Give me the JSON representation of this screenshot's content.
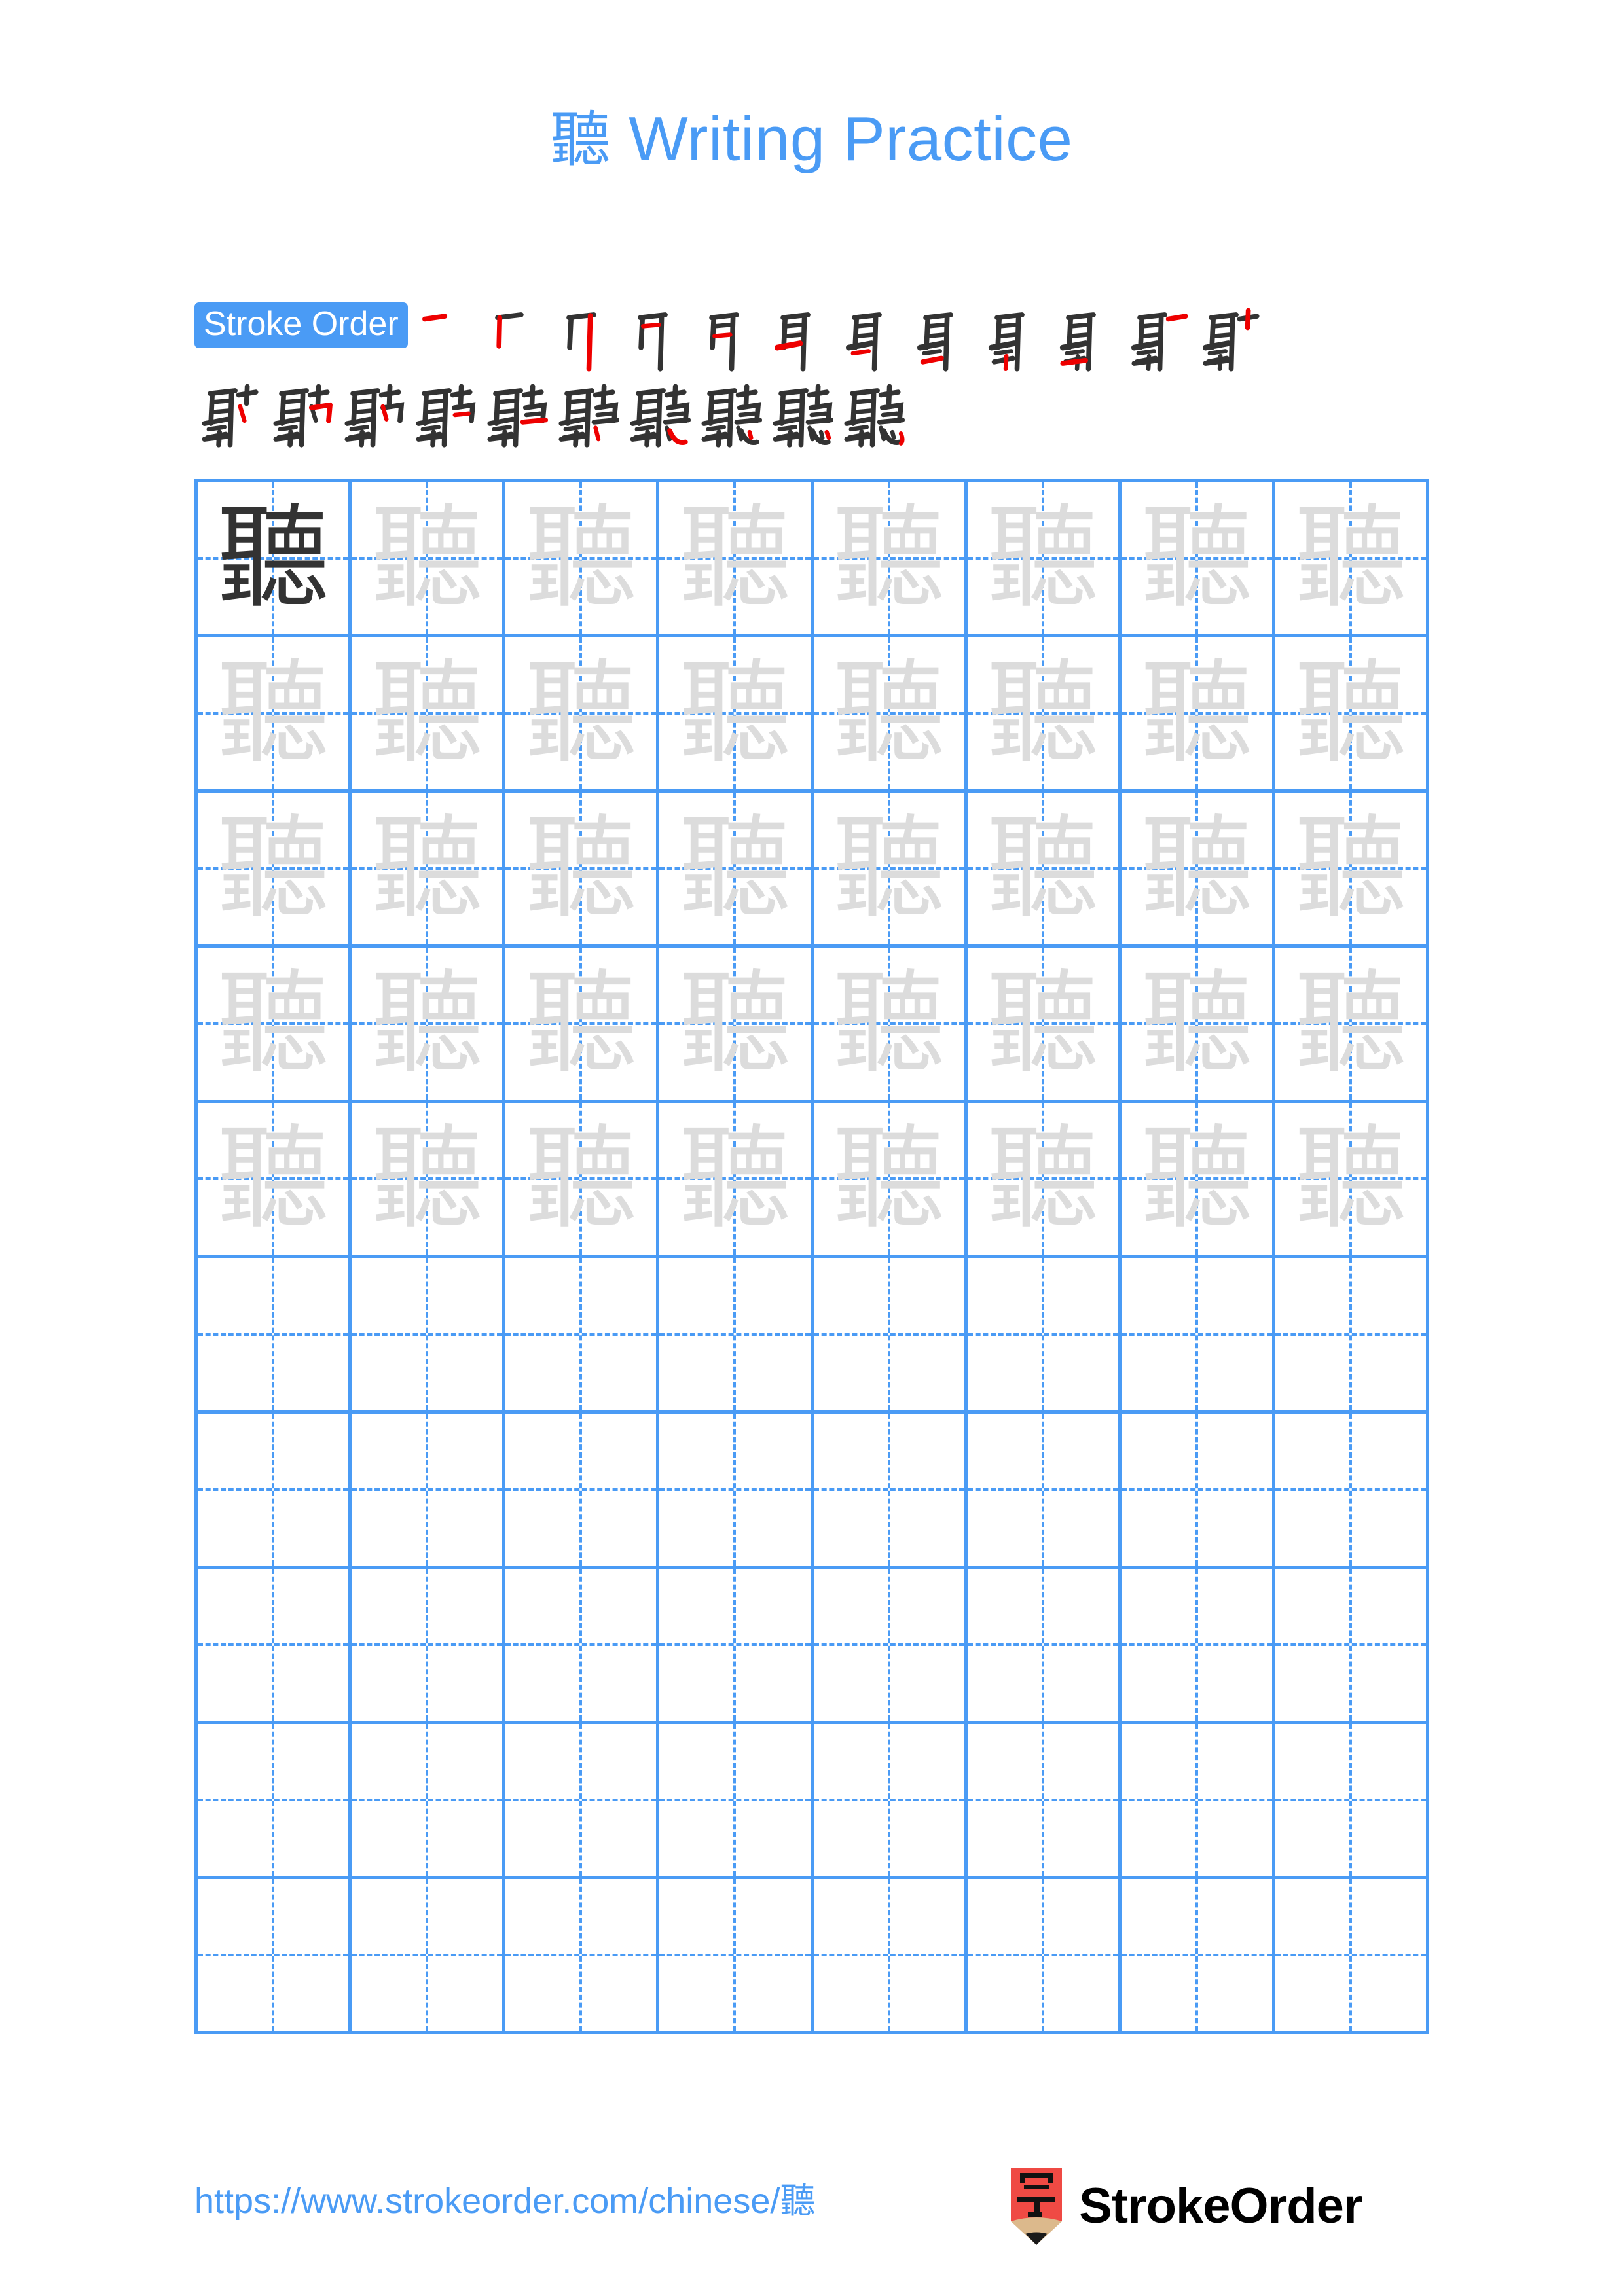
{
  "page": {
    "character": "聽",
    "title_suffix": " Writing Practice",
    "background_color": "#ffffff",
    "accent_color": "#4a9bf5",
    "trace_color": "#dcdcdc",
    "dark_color": "#333333",
    "stroke_new_color": "#ee0000",
    "stroke_old_color": "#333333"
  },
  "header": {
    "title_character": "聽",
    "title_text": "Writing Practice"
  },
  "stroke_order": {
    "badge_label": "Stroke Order",
    "total_strokes": 22,
    "row1_count": 12,
    "row2_count": 10,
    "characters_row1": [
      "一",
      "丆",
      "丌",
      "月",
      "月",
      "耳",
      "耳",
      "耳",
      "耳",
      "耵",
      "耵",
      "耺"
    ],
    "characters_row2": [
      "耺",
      "聍",
      "聍",
      "聍",
      "聽",
      "聽",
      "聽",
      "聽",
      "聽",
      "聽"
    ]
  },
  "practice_grid": {
    "columns": 8,
    "rows": 10,
    "character": "聽",
    "filled_rows": 5,
    "blank_rows": 5,
    "first_cell_style": "dark",
    "trace_cell_style": "trace",
    "rows_data": [
      [
        "dark",
        "trace",
        "trace",
        "trace",
        "trace",
        "trace",
        "trace",
        "trace"
      ],
      [
        "trace",
        "trace",
        "trace",
        "trace",
        "trace",
        "trace",
        "trace",
        "trace"
      ],
      [
        "trace",
        "trace",
        "trace",
        "trace",
        "trace",
        "trace",
        "trace",
        "trace"
      ],
      [
        "trace",
        "trace",
        "trace",
        "trace",
        "trace",
        "trace",
        "trace",
        "trace"
      ],
      [
        "trace",
        "trace",
        "trace",
        "trace",
        "trace",
        "trace",
        "trace",
        "trace"
      ],
      [
        "blank",
        "blank",
        "blank",
        "blank",
        "blank",
        "blank",
        "blank",
        "blank"
      ],
      [
        "blank",
        "blank",
        "blank",
        "blank",
        "blank",
        "blank",
        "blank",
        "blank"
      ],
      [
        "blank",
        "blank",
        "blank",
        "blank",
        "blank",
        "blank",
        "blank",
        "blank"
      ],
      [
        "blank",
        "blank",
        "blank",
        "blank",
        "blank",
        "blank",
        "blank",
        "blank"
      ],
      [
        "blank",
        "blank",
        "blank",
        "blank",
        "blank",
        "blank",
        "blank",
        "blank"
      ]
    ]
  },
  "footer": {
    "url": "https://www.strokeorder.com/chinese/聽",
    "logo_glyph": "字",
    "logo_text": "StrokeOrder",
    "logo_body_color": "#ef4a44",
    "logo_wood_color": "#dcb98c",
    "logo_tip_color": "#1a1a1a"
  }
}
